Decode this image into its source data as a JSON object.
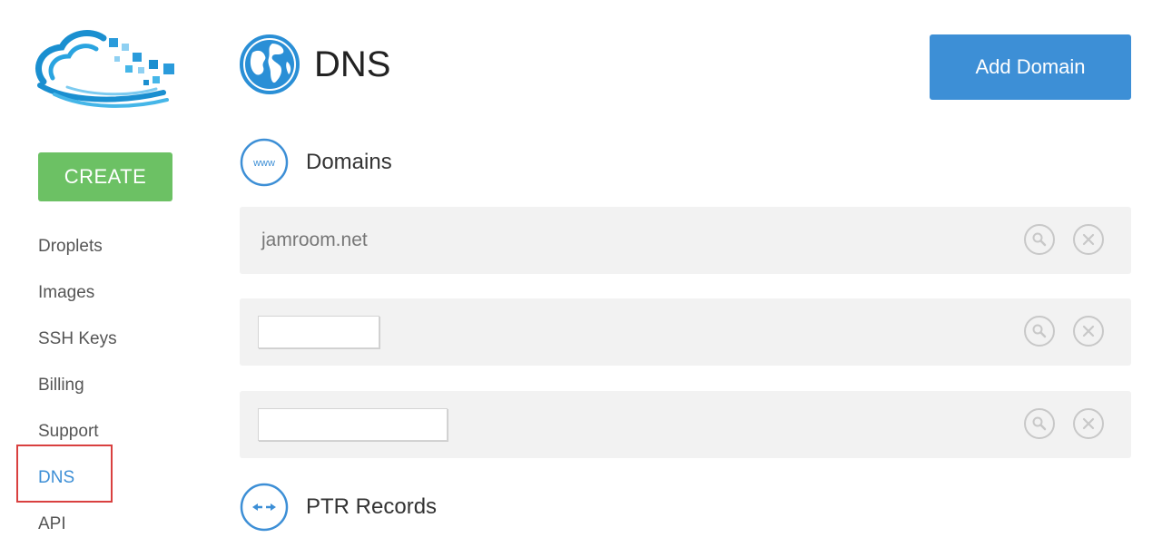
{
  "sidebar": {
    "create_label": "CREATE",
    "items": [
      {
        "label": "Droplets",
        "active": false
      },
      {
        "label": "Images",
        "active": false
      },
      {
        "label": "SSH Keys",
        "active": false
      },
      {
        "label": "Billing",
        "active": false
      },
      {
        "label": "Support",
        "active": false
      },
      {
        "label": "DNS",
        "active": true
      },
      {
        "label": "API",
        "active": false
      }
    ]
  },
  "header": {
    "title": "DNS",
    "add_domain_label": "Add Domain"
  },
  "domains_section": {
    "title": "Domains",
    "icon_text": "www",
    "rows": [
      {
        "name": "jamroom.net",
        "redacted": false
      },
      {
        "name": "",
        "redacted": true
      },
      {
        "name": "",
        "redacted": true
      }
    ]
  },
  "ptr_section": {
    "title": "PTR Records"
  },
  "icons": {
    "logo": "cloud-logo-icon",
    "globe": "globe-icon",
    "www": "www-icon",
    "ptr": "double-arrow-icon",
    "view": "magnifier-icon",
    "delete": "close-icon"
  },
  "colors": {
    "create_green": "#6cc164",
    "primary_blue": "#3d8fd6",
    "active_outline": "#d9403f",
    "row_bg": "#f2f2f2"
  }
}
